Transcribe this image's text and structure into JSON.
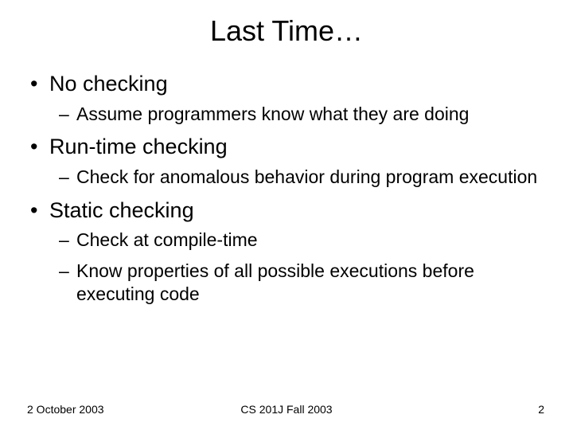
{
  "title": "Last Time…",
  "bullets": [
    {
      "text": "No checking",
      "sub": [
        "Assume programmers know what they are doing"
      ]
    },
    {
      "text": "Run-time checking",
      "sub": [
        "Check for anomalous behavior during program execution"
      ]
    },
    {
      "text": "Static checking",
      "sub": [
        "Check at compile-time",
        "Know properties of all possible executions before executing code"
      ]
    }
  ],
  "footer": {
    "left": "2 October 2003",
    "center": "CS 201J Fall 2003",
    "right": "2"
  }
}
